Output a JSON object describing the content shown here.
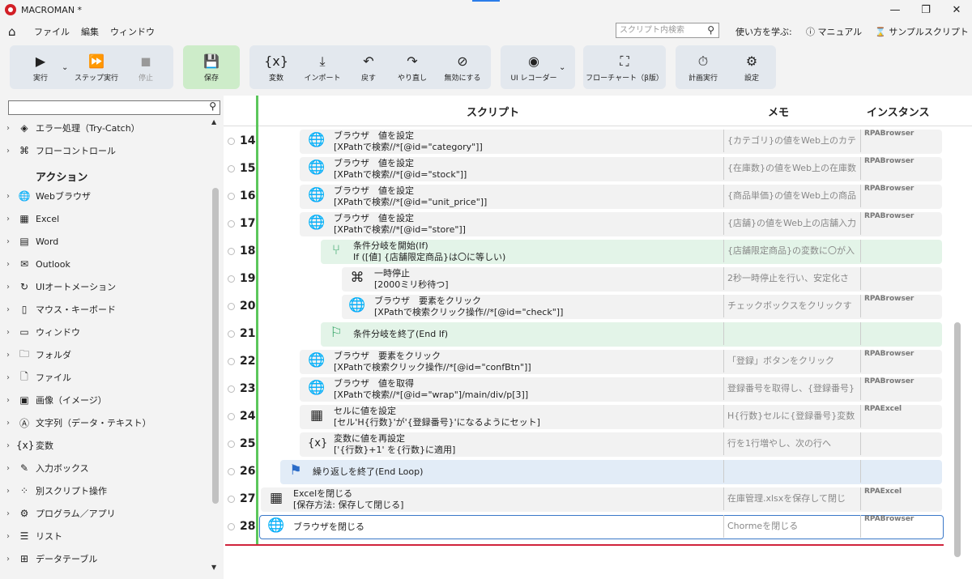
{
  "app": {
    "title": "MACROMAN *"
  },
  "menu": {
    "file": "ファイル",
    "edit": "編集",
    "window": "ウィンドウ"
  },
  "search": {
    "placeholder": "スクリプト内検索"
  },
  "help": {
    "learn": "使い方を学ぶ:",
    "manual": "マニュアル",
    "sample": "サンプルスクリプト"
  },
  "toolbar": {
    "run": "実行",
    "step_run": "ステップ実行",
    "stop": "停止",
    "save": "保存",
    "variable": "変数",
    "import": "インポート",
    "undo": "戻す",
    "redo": "やり直し",
    "disable": "無効にする",
    "ui_recorder": "UI レコーダー",
    "flowchart": "フローチャート（β版）",
    "scheduled_run": "計画実行",
    "settings": "設定"
  },
  "sidebar": {
    "items": [
      {
        "label": "エラー処理（Try-Catch）",
        "icon": "error-icon"
      },
      {
        "label": "フローコントロール",
        "icon": "command-icon"
      },
      {
        "label": "Webブラウザ",
        "icon": "globe-icon"
      },
      {
        "label": "Excel",
        "icon": "excel-icon"
      },
      {
        "label": "Word",
        "icon": "word-icon"
      },
      {
        "label": "Outlook",
        "icon": "outlook-icon"
      },
      {
        "label": "UIオートメーション",
        "icon": "ui-automation-icon"
      },
      {
        "label": "マウス・キーボード",
        "icon": "mouse-icon"
      },
      {
        "label": "ウィンドウ",
        "icon": "window-icon"
      },
      {
        "label": "フォルダ",
        "icon": "folder-icon"
      },
      {
        "label": "ファイル",
        "icon": "file-icon"
      },
      {
        "label": "画像（イメージ）",
        "icon": "image-icon"
      },
      {
        "label": "文字列（データ・テキスト）",
        "icon": "text-icon"
      },
      {
        "label": "変数",
        "icon": "variable-icon"
      },
      {
        "label": "入力ボックス",
        "icon": "input-box-icon"
      },
      {
        "label": "別スクリプト操作",
        "icon": "script-icon"
      },
      {
        "label": "プログラム／アプリ",
        "icon": "program-icon"
      },
      {
        "label": "リスト",
        "icon": "list-icon"
      },
      {
        "label": "データテーブル",
        "icon": "datatable-icon"
      }
    ],
    "section_header": "アクション"
  },
  "columns": {
    "script": "スクリプト",
    "memo": "メモ",
    "instance": "インスタンス"
  },
  "rows": [
    {
      "num": "14",
      "line1": "ブラウザ　値を設定",
      "line2": "[XPathで検索//*[@id=\"category\"]]",
      "memo": "{カテゴリ}の値をWeb上のカテ",
      "inst": "RPABrowser"
    },
    {
      "num": "15",
      "line1": "ブラウザ　値を設定",
      "line2": "[XPathで検索//*[@id=\"stock\"]]",
      "memo": "{在庫数}の値をWeb上の在庫数",
      "inst": "RPABrowser"
    },
    {
      "num": "16",
      "line1": "ブラウザ　値を設定",
      "line2": "[XPathで検索//*[@id=\"unit_price\"]]",
      "memo": "{商品単価}の値をWeb上の商品",
      "inst": "RPABrowser"
    },
    {
      "num": "17",
      "line1": "ブラウザ　値を設定",
      "line2": "[XPathで検索//*[@id=\"store\"]]",
      "memo": "{店舗}の値をWeb上の店舗入力",
      "inst": "RPABrowser"
    },
    {
      "num": "18",
      "line1": "条件分岐を開始(If)",
      "line2": "If ([値] {店舗限定商品}は〇に等しい)",
      "memo": "{店舗限定商品}の変数に〇が入",
      "inst": ""
    },
    {
      "num": "19",
      "line1": "一時停止",
      "line2": "[2000ミリ秒待つ]",
      "memo": "2秒一時停止を行い、安定化さ",
      "inst": ""
    },
    {
      "num": "20",
      "line1": "ブラウザ　要素をクリック",
      "line2": "[XPathで検索クリック操作//*[@id=\"check\"]]",
      "memo": "チェックボックスをクリックす",
      "inst": "RPABrowser"
    },
    {
      "num": "21",
      "line1": "条件分岐を終了(End If)",
      "line2": "",
      "memo": "",
      "inst": ""
    },
    {
      "num": "22",
      "line1": "ブラウザ　要素をクリック",
      "line2": "[XPathで検索クリック操作//*[@id=\"confBtn\"]]",
      "memo": "「登録」ボタンをクリック",
      "inst": "RPABrowser"
    },
    {
      "num": "23",
      "line1": "ブラウザ　値を取得",
      "line2": "[XPathで検索//*[@id=\"wrap\"]/main/div/p[3]]",
      "memo": "登録番号を取得し、{登録番号}",
      "inst": "RPABrowser"
    },
    {
      "num": "24",
      "line1": "セルに値を設定",
      "line2": "[セル'H{行数}'が'{登録番号}'になるようにセット]",
      "memo": "H{行数}セルに{登録番号}変数",
      "inst": "RPAExcel"
    },
    {
      "num": "25",
      "line1": "変数に値を再設定",
      "line2": "['{行数}+1' を{行数}に適用]",
      "memo": "行を1行増やし、次の行へ",
      "inst": ""
    },
    {
      "num": "26",
      "line1": "繰り返しを終了(End Loop)",
      "line2": "",
      "memo": "",
      "inst": ""
    },
    {
      "num": "27",
      "line1": "Excelを閉じる",
      "line2": "[保存方法: 保存して閉じる]",
      "memo": "在庫管理.xlsxを保存して閉じ",
      "inst": "RPAExcel"
    },
    {
      "num": "28",
      "line1": "ブラウザを閉じる",
      "line2": "",
      "memo": "Chormeを閉じる",
      "inst": "RPABrowser"
    }
  ]
}
